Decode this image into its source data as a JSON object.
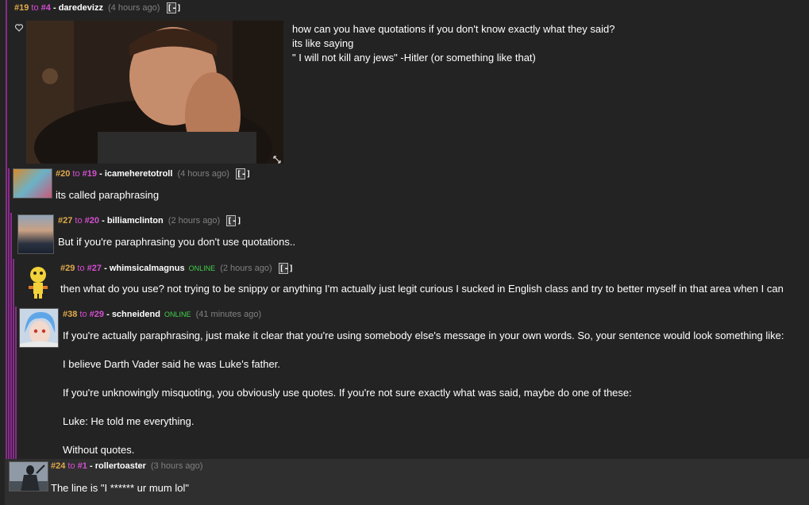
{
  "comments": [
    {
      "num": "#19",
      "to": "to",
      "ref": "#4",
      "user": "daredevizz",
      "online": "",
      "time": "(4 hours ago)",
      "lines": [
        "how can you have quotations if you don't know exactly what they said?",
        "its like saying",
        "\" I will not kill any jews\" -Hitler (or something like that)"
      ]
    },
    {
      "num": "#20",
      "to": "to",
      "ref": "#19",
      "user": "icameheretotroll",
      "online": "",
      "time": "(4 hours ago)",
      "lines": [
        "its called paraphrasing"
      ]
    },
    {
      "num": "#27",
      "to": "to",
      "ref": "#20",
      "user": "billiamclinton",
      "online": "",
      "time": "(2 hours ago)",
      "lines": [
        "But if you're paraphrasing you don't use quotations.."
      ]
    },
    {
      "num": "#29",
      "to": "to",
      "ref": "#27",
      "user": "whimsicalmagnus",
      "online": "ONLINE",
      "time": "(2 hours ago)",
      "lines": [
        "then what do you use? not trying to be snippy or anything I'm actually just legit curious I sucked in English class and try to better myself in that area when I can"
      ]
    },
    {
      "num": "#38",
      "to": "to",
      "ref": "#29",
      "user": "schneidend",
      "online": "ONLINE",
      "time": "(41 minutes ago)",
      "lines": [
        "If you're actually paraphrasing, just make it clear that you're using somebody else's message in your own words. So, your sentence would look something like:",
        "I believe Darth Vader said he was Luke's father.",
        "If you're unknowingly misquoting, you obviously use quotes. If you're not sure exactly what was said, maybe do one of these:",
        "Luke: He told me everything.",
        "Without quotes."
      ]
    },
    {
      "num": "#24",
      "to": "to",
      "ref": "#1",
      "user": "rollertoaster",
      "online": "",
      "time": "(3 hours ago)",
      "lines": [
        "The line is \"I ****** ur mum lol\""
      ]
    }
  ],
  "collapse_label": "[-]",
  "dash": " - ",
  "colors": {
    "background": "#232323",
    "thread_line": "#8a2a8e",
    "comment_num": "#e2ab4b",
    "reply_link": "#d64fd2",
    "online": "#43d04b",
    "time": "#808080",
    "censor": "#d64fd2"
  }
}
